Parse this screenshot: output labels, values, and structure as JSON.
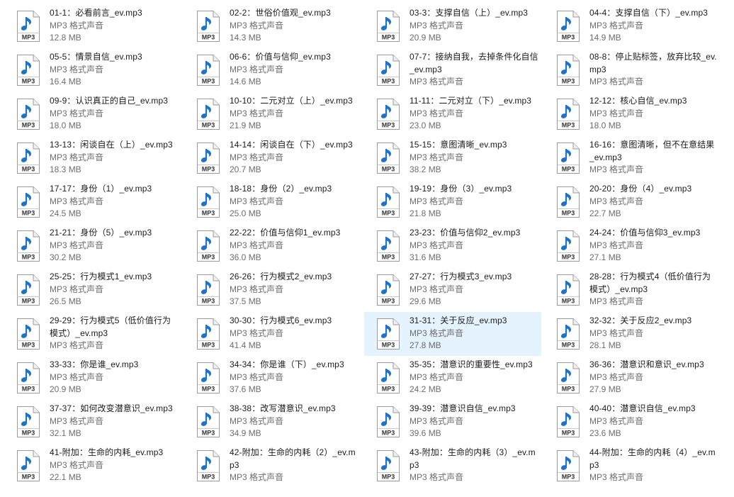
{
  "files": [
    {
      "name": "01-1：必看前言_ev.mp3",
      "type": "MP3 格式声音",
      "size": "12.8 MB"
    },
    {
      "name": "02-2：世俗价值观_ev.mp3",
      "type": "MP3 格式声音",
      "size": "14.3 MB"
    },
    {
      "name": "03-3：支撑自信（上）_ev.mp3",
      "type": "MP3 格式声音",
      "size": "20.9 MB"
    },
    {
      "name": "04-4：支撑自信（下）_ev.mp3",
      "type": "MP3 格式声音",
      "size": "14.9 MB"
    },
    {
      "name": "05-5：情景自信_ev.mp3",
      "type": "MP3 格式声音",
      "size": "16.4 MB"
    },
    {
      "name": "06-6：价值与信仰_ev.mp3",
      "type": "MP3 格式声音",
      "size": "14.6 MB"
    },
    {
      "name": "07-7：接纳自我，去掉条件化自信_ev.mp3",
      "type": "MP3 格式声音",
      "size": ""
    },
    {
      "name": "08-8：停止贴标签，放弃比较_ev.mp3",
      "type": "MP3 格式声音",
      "size": ""
    },
    {
      "name": "09-9：认识真正的自己_ev.mp3",
      "type": "MP3 格式声音",
      "size": "18.0 MB"
    },
    {
      "name": "10-10：二元对立（上）_ev.mp3",
      "type": "MP3 格式声音",
      "size": "21.9 MB"
    },
    {
      "name": "11-11：二元对立（下）_ev.mp3",
      "type": "MP3 格式声音",
      "size": "23.0 MB"
    },
    {
      "name": "12-12：核心自信_ev.mp3",
      "type": "MP3 格式声音",
      "size": "18.0 MB"
    },
    {
      "name": "13-13：闲谈自在（上）_ev.mp3",
      "type": "MP3 格式声音",
      "size": "18.3 MB"
    },
    {
      "name": "14-14：闲谈自在（下）_ev.mp3",
      "type": "MP3 格式声音",
      "size": "20.7 MB"
    },
    {
      "name": "15-15：意图清晰_ev.mp3",
      "type": "MP3 格式声音",
      "size": "38.2 MB"
    },
    {
      "name": "16-16：意图清晰，但不在意结果_ev.mp3",
      "type": "MP3 格式声音",
      "size": ""
    },
    {
      "name": "17-17：身份（1）_ev.mp3",
      "type": "MP3 格式声音",
      "size": "24.5 MB"
    },
    {
      "name": "18-18：身份（2）_ev.mp3",
      "type": "MP3 格式声音",
      "size": "25.0 MB"
    },
    {
      "name": "19-19：身份（3）_ev.mp3",
      "type": "MP3 格式声音",
      "size": "21.8 MB"
    },
    {
      "name": "20-20：身份（4）_ev.mp3",
      "type": "MP3 格式声音",
      "size": "22.7 MB"
    },
    {
      "name": "21-21：身份（5）_ev.mp3",
      "type": "MP3 格式声音",
      "size": "30.2 MB"
    },
    {
      "name": "22-22：价值与信仰1_ev.mp3",
      "type": "MP3 格式声音",
      "size": "36.0 MB"
    },
    {
      "name": "23-23：价值与信仰2_ev.mp3",
      "type": "MP3 格式声音",
      "size": "31.6 MB"
    },
    {
      "name": "24-24：价值与信仰3_ev.mp3",
      "type": "MP3 格式声音",
      "size": "27.1 MB"
    },
    {
      "name": "25-25：行为模式1_ev.mp3",
      "type": "MP3 格式声音",
      "size": "26.5 MB"
    },
    {
      "name": "26-26：行为模式2_ev.mp3",
      "type": "MP3 格式声音",
      "size": "37.5 MB"
    },
    {
      "name": "27-27：行为模式3_ev.mp3",
      "type": "MP3 格式声音",
      "size": "29.6 MB"
    },
    {
      "name": "28-28：行为模式4（低价值行为模式）_ev.mp3",
      "type": "MP3 格式声音",
      "size": ""
    },
    {
      "name": "29-29：行为模式5（低价值行为模式）_ev.mp3",
      "type": "MP3 格式声音",
      "size": ""
    },
    {
      "name": "30-30：行为模式6_ev.mp3",
      "type": "MP3 格式声音",
      "size": "41.4 MB"
    },
    {
      "name": "31-31：关于反应_ev.mp3",
      "type": "MP3 格式声音",
      "size": "27.8 MB",
      "selected": true
    },
    {
      "name": "32-32：关于反应2_ev.mp3",
      "type": "MP3 格式声音",
      "size": "28.1 MB"
    },
    {
      "name": "33-33：你是谁_ev.mp3",
      "type": "MP3 格式声音",
      "size": "20.9 MB"
    },
    {
      "name": "34-34：你是谁（下）_ev.mp3",
      "type": "MP3 格式声音",
      "size": "37.6 MB"
    },
    {
      "name": "35-35：潜意识的重要性_ev.mp3",
      "type": "MP3 格式声音",
      "size": "24.2 MB"
    },
    {
      "name": "36-36：潜意识和意识_ev.mp3",
      "type": "MP3 格式声音",
      "size": "27.9 MB"
    },
    {
      "name": "37-37：如何改变潜意识_ev.mp3",
      "type": "MP3 格式声音",
      "size": "32.1 MB"
    },
    {
      "name": "38-38：改写潜意识_ev.mp3",
      "type": "MP3 格式声音",
      "size": "34.9 MB"
    },
    {
      "name": "39-39：潜意识自信_ev.mp3",
      "type": "MP3 格式声音",
      "size": "39.6 MB"
    },
    {
      "name": "40-40：潜意识自信_ev.mp3",
      "type": "MP3 格式声音",
      "size": "23.6 MB"
    },
    {
      "name": "41-附加：生命的内耗_ev.mp3",
      "type": "MP3 格式声音",
      "size": "22.1 MB"
    },
    {
      "name": "42-附加：生命的内耗（2）_ev.mp3",
      "type": "MP3 格式声音",
      "size": ""
    },
    {
      "name": "43-附加：生命的内耗（3）_ev.mp3",
      "type": "MP3 格式声音",
      "size": ""
    },
    {
      "name": "44-附加：生命的内耗（4）_ev.mp3",
      "type": "MP3 格式声音",
      "size": ""
    }
  ],
  "icon": {
    "name": "mp3-file-icon",
    "badge_text": "MP3",
    "note_color": "#1e73c8",
    "page_color": "#ffffff",
    "border_color": "#9a9a9a"
  },
  "colors": {
    "selection_background": "#e5f3ff"
  }
}
